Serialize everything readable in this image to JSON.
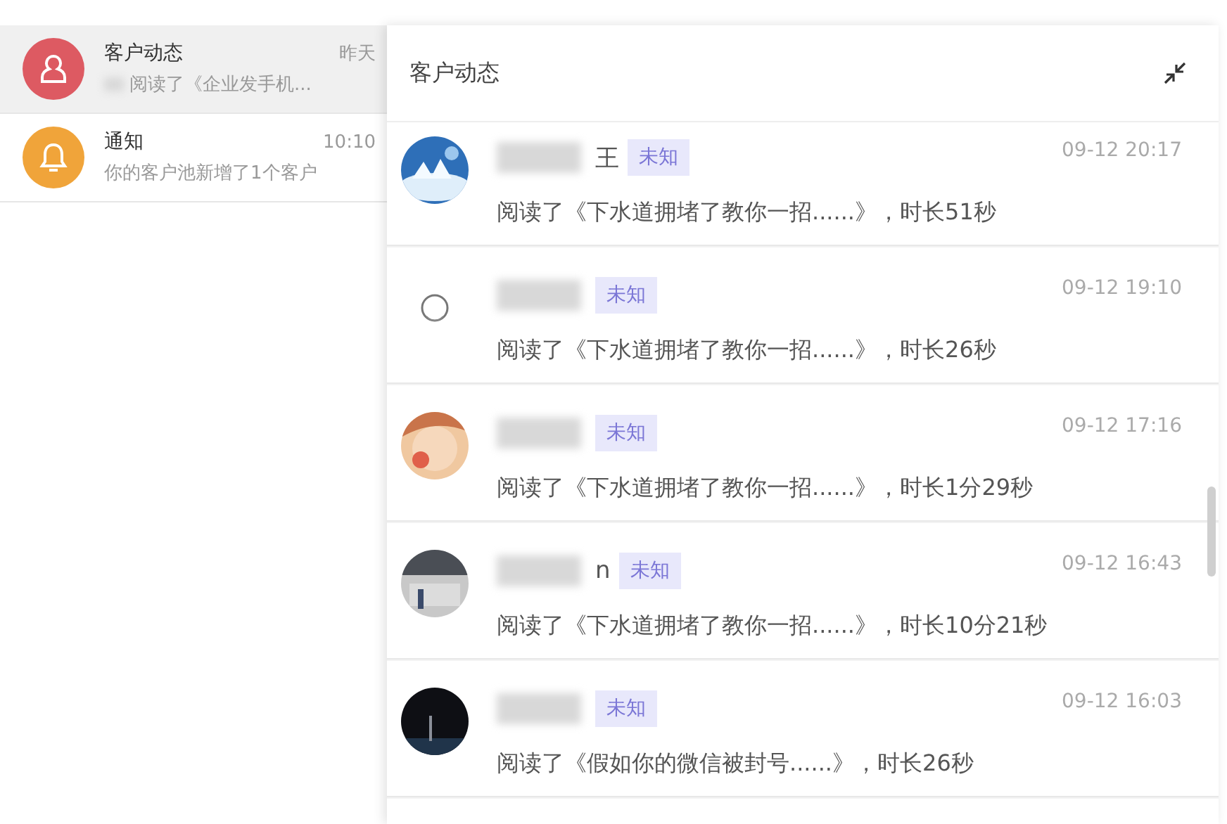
{
  "sidebar": {
    "items": [
      {
        "kind": "customer",
        "title": "客户动态",
        "time": "昨天",
        "preview": "阅读了《企业发手机...",
        "blurred": true,
        "selected": true,
        "color": "#dd5a62"
      },
      {
        "kind": "notice",
        "title": "通知",
        "time": "10:10",
        "preview": "你的客户池新增了1个客户",
        "blurred": false,
        "selected": false,
        "color": "#f0a43a"
      }
    ]
  },
  "panel": {
    "title": "客户动态",
    "feed": [
      {
        "name_tail": "王",
        "tag": "未知",
        "time": "09-12 20:17",
        "text": "阅读了《下水道拥堵了教你一招......》，时长51秒"
      },
      {
        "tag": "未知",
        "time": "09-12 19:10",
        "text": "阅读了《下水道拥堵了教你一招......》，时长26秒"
      },
      {
        "tag": "未知",
        "time": "09-12 17:16",
        "text": "阅读了《下水道拥堵了教你一招......》，时长1分29秒"
      },
      {
        "name_tail": "n",
        "tag": "未知",
        "time": "09-12 16:43",
        "text": "阅读了《下水道拥堵了教你一招......》，时长10分21秒"
      },
      {
        "tag": "未知",
        "time": "09-12 16:03",
        "text": "阅读了《假如你的微信被封号......》，时长26秒"
      }
    ]
  }
}
